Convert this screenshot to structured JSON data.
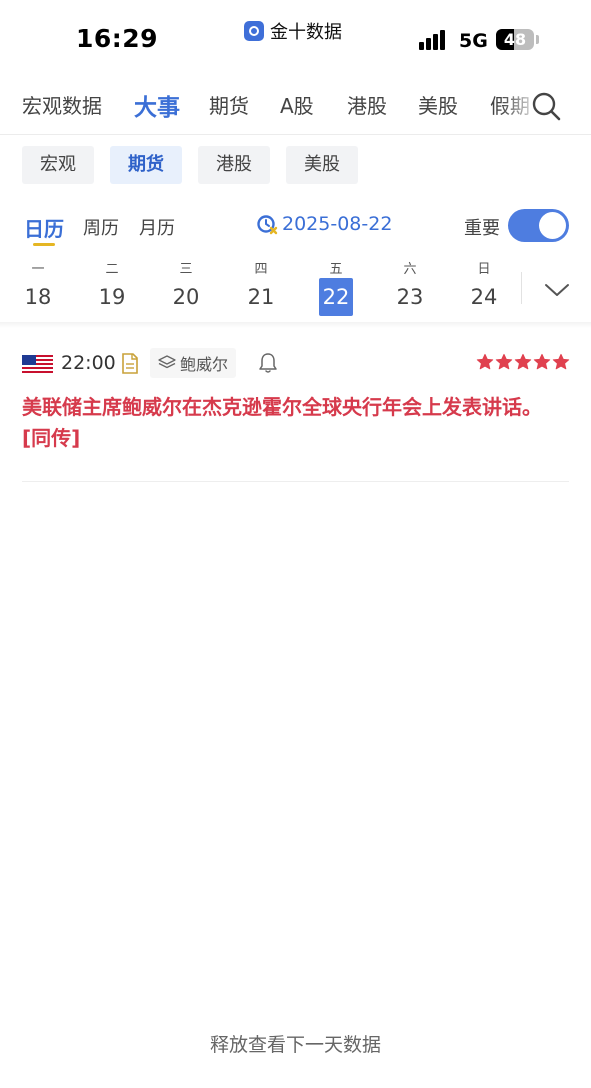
{
  "status_bar": {
    "time": "16:29",
    "app_name": "金十数据",
    "network": "5G",
    "battery": "48",
    "battery_level": 0.48
  },
  "category_tabs": [
    {
      "label": "宏观数据",
      "active": false
    },
    {
      "label": "大事",
      "active": true
    },
    {
      "label": "期货",
      "active": false
    },
    {
      "label": "A股",
      "active": false
    },
    {
      "label": "港股",
      "active": false
    },
    {
      "label": "美股",
      "active": false
    },
    {
      "label": "假期",
      "active": false
    }
  ],
  "market_chips": [
    {
      "label": "宏观",
      "active": false
    },
    {
      "label": "期货",
      "active": true
    },
    {
      "label": "港股",
      "active": false
    },
    {
      "label": "美股",
      "active": false
    }
  ],
  "periods": [
    {
      "label": "日历",
      "active": true
    },
    {
      "label": "周历",
      "active": false
    },
    {
      "label": "月历",
      "active": false
    }
  ],
  "selected_date": "2025-08-22",
  "important_filter": {
    "label": "重要",
    "on": true
  },
  "week": [
    {
      "weekday": "一",
      "day": "18",
      "selected": false
    },
    {
      "weekday": "二",
      "day": "19",
      "selected": false
    },
    {
      "weekday": "三",
      "day": "20",
      "selected": false
    },
    {
      "weekday": "四",
      "day": "21",
      "selected": false
    },
    {
      "weekday": "五",
      "day": "22",
      "selected": true
    },
    {
      "weekday": "六",
      "day": "23",
      "selected": false
    },
    {
      "weekday": "日",
      "day": "24",
      "selected": false
    }
  ],
  "events": [
    {
      "country_flag": "us-flag-icon",
      "time": "22:00",
      "tag": "鲍威尔",
      "stars": 5,
      "title": "美联储主席鲍威尔在杰克逊霍尔全球央行年会上发表讲话。[同传]"
    }
  ],
  "colors": {
    "accent": "#3b6fd6",
    "event_title": "#d63a4c",
    "star": "#e0414f",
    "underline": "#e5b623"
  },
  "pull_hint": "释放查看下一天数据"
}
